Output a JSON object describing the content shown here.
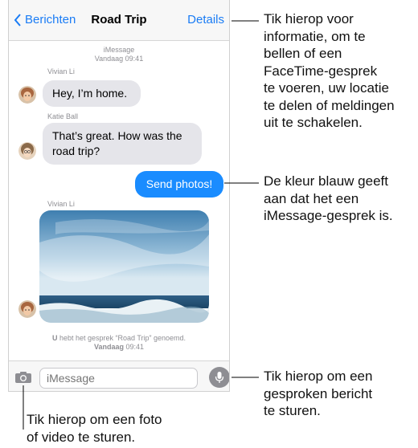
{
  "navbar": {
    "back_label": "Berichten",
    "title": "Road Trip",
    "details_label": "Details"
  },
  "conversation": {
    "header_service": "iMessage",
    "header_time_label": "Vandaag",
    "header_time": "09:41",
    "messages": [
      {
        "sender": "Vivian Li",
        "text": "Hey, I’m home."
      },
      {
        "sender": "Katie Ball",
        "text": "That’s great. How was the road trip?"
      },
      {
        "sender": "",
        "text": "Send photos!"
      },
      {
        "sender": "Vivian Li",
        "text": ""
      }
    ],
    "rename_notice_user": "U",
    "rename_notice_text": "hebt het gesprek “Road Trip” genoemd.",
    "footer_time_label": "Vandaag",
    "footer_time": "09:41"
  },
  "input": {
    "placeholder": "iMessage"
  },
  "icons": {
    "back": "chevron-left-icon",
    "camera": "camera-icon",
    "mic": "microphone-icon"
  },
  "colors": {
    "accent": "#1a7cf5",
    "imessage_bubble": "#1a8cff",
    "incoming_bubble": "#e5e5ea"
  },
  "callouts": {
    "details": [
      "Tik hierop voor",
      "informatie, om te",
      "bellen of een",
      "FaceTime-gesprek",
      "te voeren, uw locatie",
      "te delen of meldingen",
      "uit te schakelen."
    ],
    "blue": [
      "De kleur blauw geeft",
      "aan dat het een",
      "iMessage-gesprek is."
    ],
    "mic": [
      "Tik hierop om een",
      "gesproken bericht",
      "te sturen."
    ],
    "camera": [
      "Tik hierop om een foto",
      "of video te sturen."
    ]
  }
}
